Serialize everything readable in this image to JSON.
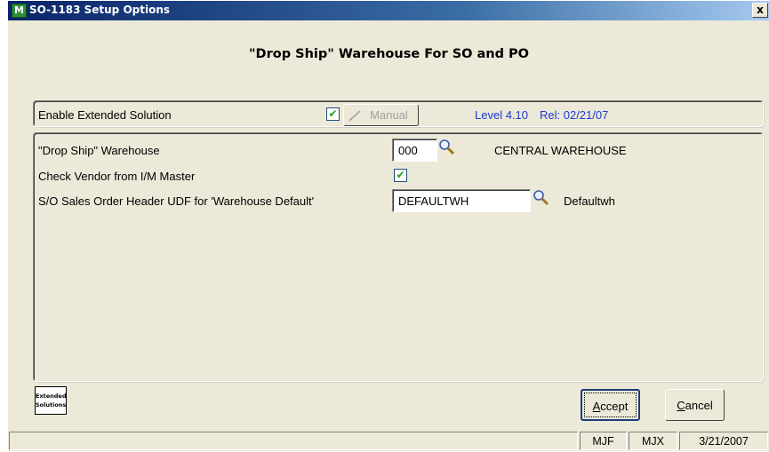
{
  "window": {
    "title": "SO-1183 Setup Options",
    "close_label": "x",
    "icon_label": "M"
  },
  "heading": "\"Drop Ship\" Warehouse For SO and PO",
  "extended": {
    "label": "Enable Extended Solution",
    "enabled": true,
    "manual_label": "Manual",
    "level": "Level 4.10",
    "release": "Rel: 02/21/07"
  },
  "fields": {
    "drop_ship_label": "\"Drop Ship\" Warehouse",
    "drop_ship_value": "000",
    "drop_ship_desc": "CENTRAL WAREHOUSE",
    "check_vendor_label": "Check Vendor from I/M Master",
    "check_vendor_checked": true,
    "udf_label": "S/O Sales Order Header UDF for 'Warehouse Default'",
    "udf_value": "DEFAULTWH",
    "udf_desc": "Defaultwh"
  },
  "logo": {
    "line1": "Extended",
    "line2": "Solutions"
  },
  "buttons": {
    "accept_hotkey": "A",
    "accept_rest": "ccept",
    "cancel_hotkey": "C",
    "cancel_rest": "ancel"
  },
  "status": {
    "cell1": "MJF",
    "cell2": "MJX",
    "cell3": "3/21/2007"
  },
  "colors": {
    "check": "#21a121",
    "info_text": "#1a3ccf"
  }
}
